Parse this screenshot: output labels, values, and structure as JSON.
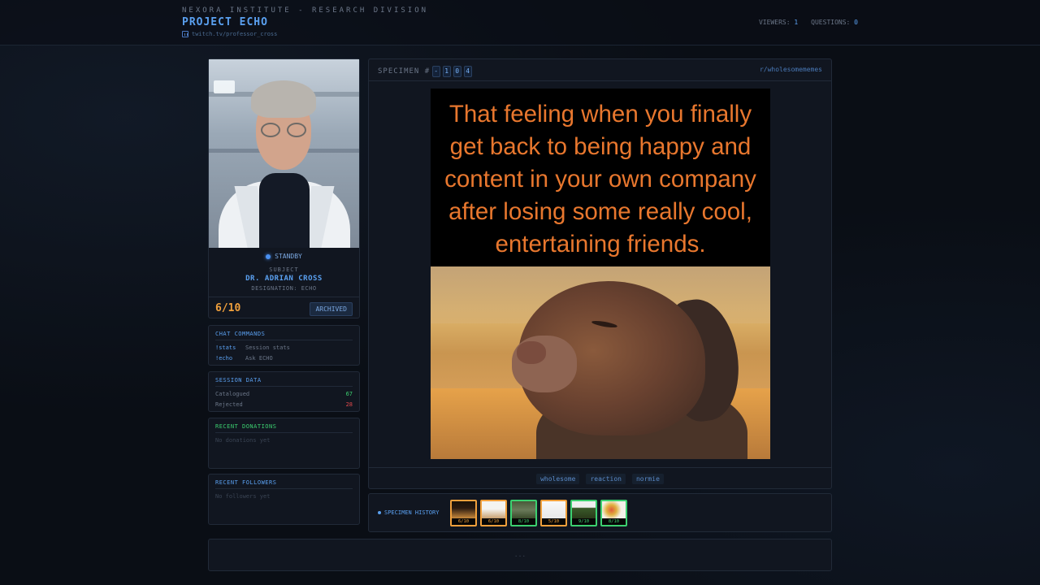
{
  "header": {
    "org": "NEXORA INSTITUTE - RESEARCH DIVISION",
    "project": "PROJECT ECHO",
    "channel": "twitch.tv/professor_cross",
    "viewers_label": "VIEWERS:",
    "viewers_value": "1",
    "questions_label": "QUESTIONS:",
    "questions_value": "0"
  },
  "subject": {
    "status": "STANDBY",
    "label": "SUBJECT",
    "name": "DR. ADRIAN CROSS",
    "designation": "DESIGNATION: ECHO",
    "score": "6/10",
    "archived_label": "ARCHIVED"
  },
  "commands": {
    "title": "CHAT COMMANDS",
    "items": [
      {
        "cmd": "!stats",
        "desc": "Session stats"
      },
      {
        "cmd": "!echo",
        "desc": "Ask ECHO"
      }
    ]
  },
  "session": {
    "title": "SESSION DATA",
    "catalogued_label": "Catalogued",
    "catalogued_value": "67",
    "rejected_label": "Rejected",
    "rejected_value": "28",
    "colors": {
      "catalogued": "#3cd070",
      "rejected": "#e0484c"
    }
  },
  "donations": {
    "title": "RECENT DONATIONS",
    "empty": "No donations yet"
  },
  "followers": {
    "title": "RECENT FOLLOWERS",
    "empty": "No followers yet"
  },
  "specimen": {
    "label": "SPECIMEN #",
    "digits": [
      "-",
      "1",
      "0",
      "4"
    ],
    "subreddit": "r/wholesomememes",
    "meme_text": "That feeling when you finally get back to being happy and content in your own company after losing some really cool, entertaining friends.",
    "tags": [
      "wholesome",
      "reaction",
      "normie"
    ]
  },
  "history": {
    "label": "SPECIMEN HISTORY",
    "items": [
      {
        "score": "6/10",
        "tone": "orange"
      },
      {
        "score": "6/10",
        "tone": "orange"
      },
      {
        "score": "8/10",
        "tone": "green"
      },
      {
        "score": "5/10",
        "tone": "orange"
      },
      {
        "score": "9/10",
        "tone": "green"
      },
      {
        "score": "8/10",
        "tone": "green"
      }
    ]
  },
  "footer": {
    "dots": "..."
  },
  "icons": [
    "twitch-icon",
    "status-dot-icon",
    "history-dot-icon"
  ],
  "colors": {
    "accent": "#5aa0f0",
    "score": "#f0a03c",
    "meme_text": "#e8772e",
    "background": "#0a0e15"
  }
}
